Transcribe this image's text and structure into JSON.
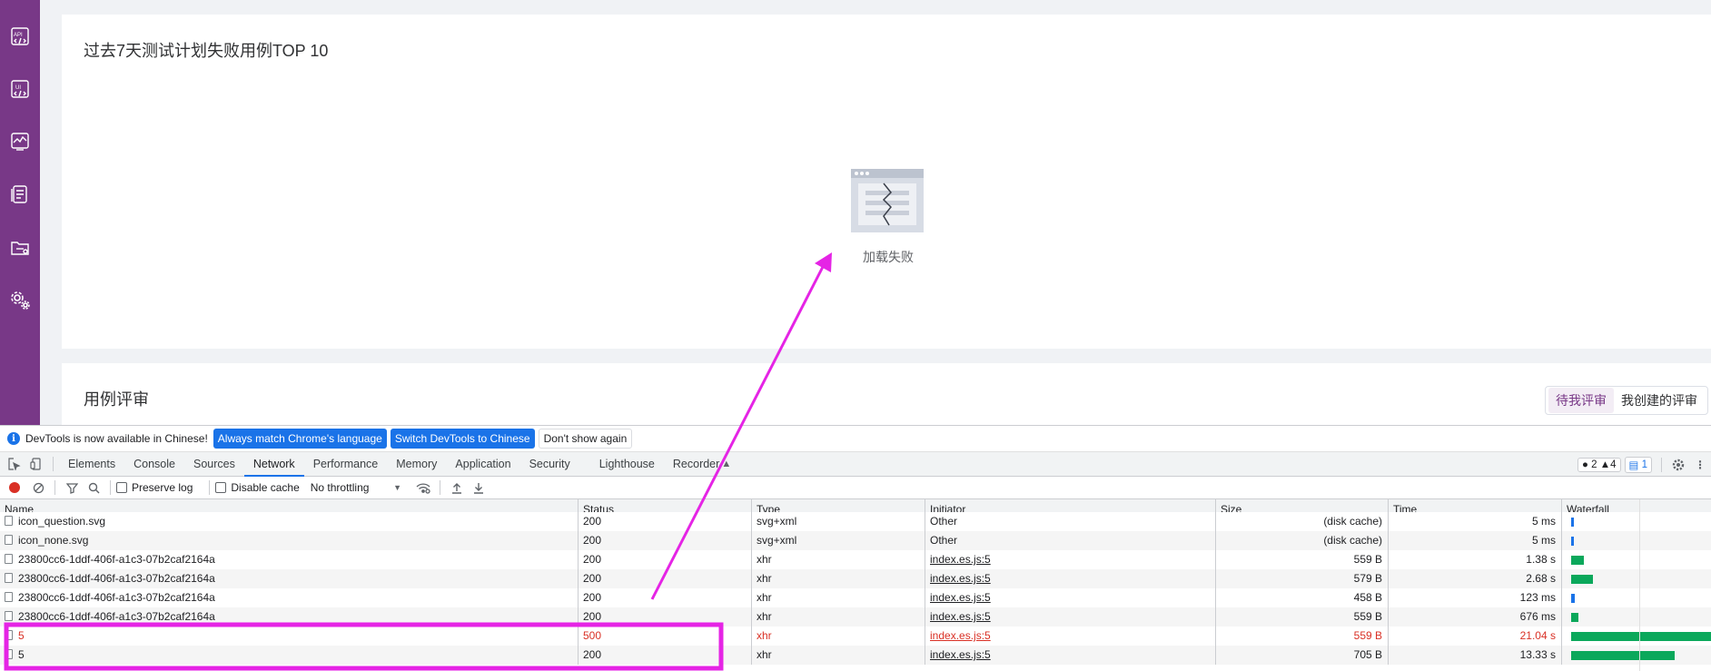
{
  "app": {
    "card1_title": "过去7天测试计划失败用例TOP 10",
    "empty_text": "加载失败",
    "card2_title": "用例评审",
    "segment": [
      "待我评审",
      "我创建的评审"
    ]
  },
  "sidebar": {
    "items": [
      {
        "icon": "api-icon"
      },
      {
        "icon": "ui-test-icon"
      },
      {
        "icon": "performance-icon"
      },
      {
        "icon": "report-icon"
      },
      {
        "icon": "project-folder-icon"
      },
      {
        "icon": "settings-gears-icon"
      }
    ]
  },
  "devtools": {
    "infobar": {
      "text": "DevTools is now available in Chinese!",
      "btn_match": "Always match Chrome's language",
      "btn_switch": "Switch DevTools to Chinese",
      "btn_dont": "Don't show again"
    },
    "tabs": [
      "Elements",
      "Console",
      "Sources",
      "Network",
      "Performance",
      "Memory",
      "Application",
      "Security",
      "Lighthouse",
      "Recorder"
    ],
    "active_tab": "Network",
    "badges": {
      "errors": "2",
      "warnings": "4",
      "messages": "1"
    },
    "toolbar": {
      "preserve_log": "Preserve log",
      "disable_cache": "Disable cache",
      "throttling": "No throttling"
    },
    "columns": [
      "Name",
      "Status",
      "Type",
      "Initiator",
      "Size",
      "Time",
      "Waterfall"
    ],
    "rows": [
      {
        "name": "icon_question.svg",
        "status": "200",
        "type": "svg+xml",
        "initiator": "Other",
        "size": "(disk cache)",
        "time": "5 ms",
        "error": false,
        "link": false
      },
      {
        "name": "icon_none.svg",
        "status": "200",
        "type": "svg+xml",
        "initiator": "Other",
        "size": "(disk cache)",
        "time": "5 ms",
        "error": false,
        "link": false
      },
      {
        "name": "23800cc6-1ddf-406f-a1c3-07b2caf2164a",
        "status": "200",
        "type": "xhr",
        "initiator": "index.es.js:5",
        "size": "559 B",
        "time": "1.38 s",
        "error": false,
        "link": true
      },
      {
        "name": "23800cc6-1ddf-406f-a1c3-07b2caf2164a",
        "status": "200",
        "type": "xhr",
        "initiator": "index.es.js:5",
        "size": "579 B",
        "time": "2.68 s",
        "error": false,
        "link": true
      },
      {
        "name": "23800cc6-1ddf-406f-a1c3-07b2caf2164a",
        "status": "200",
        "type": "xhr",
        "initiator": "index.es.js:5",
        "size": "458 B",
        "time": "123 ms",
        "error": false,
        "link": true
      },
      {
        "name": "23800cc6-1ddf-406f-a1c3-07b2caf2164a",
        "status": "200",
        "type": "xhr",
        "initiator": "index.es.js:5",
        "size": "559 B",
        "time": "676 ms",
        "error": false,
        "link": true
      },
      {
        "name": "5",
        "status": "500",
        "type": "xhr",
        "initiator": "index.es.js:5",
        "size": "559 B",
        "time": "21.04 s",
        "error": true,
        "link": true
      },
      {
        "name": "5",
        "status": "200",
        "type": "xhr",
        "initiator": "index.es.js:5",
        "size": "705 B",
        "time": "13.33 s",
        "error": false,
        "link": true
      }
    ]
  },
  "colors": {
    "sidebar": "#783887",
    "highlight": "#e524e5",
    "error": "#d93025",
    "waterfall": "#0ba85b",
    "accent": "#1a73e8"
  }
}
